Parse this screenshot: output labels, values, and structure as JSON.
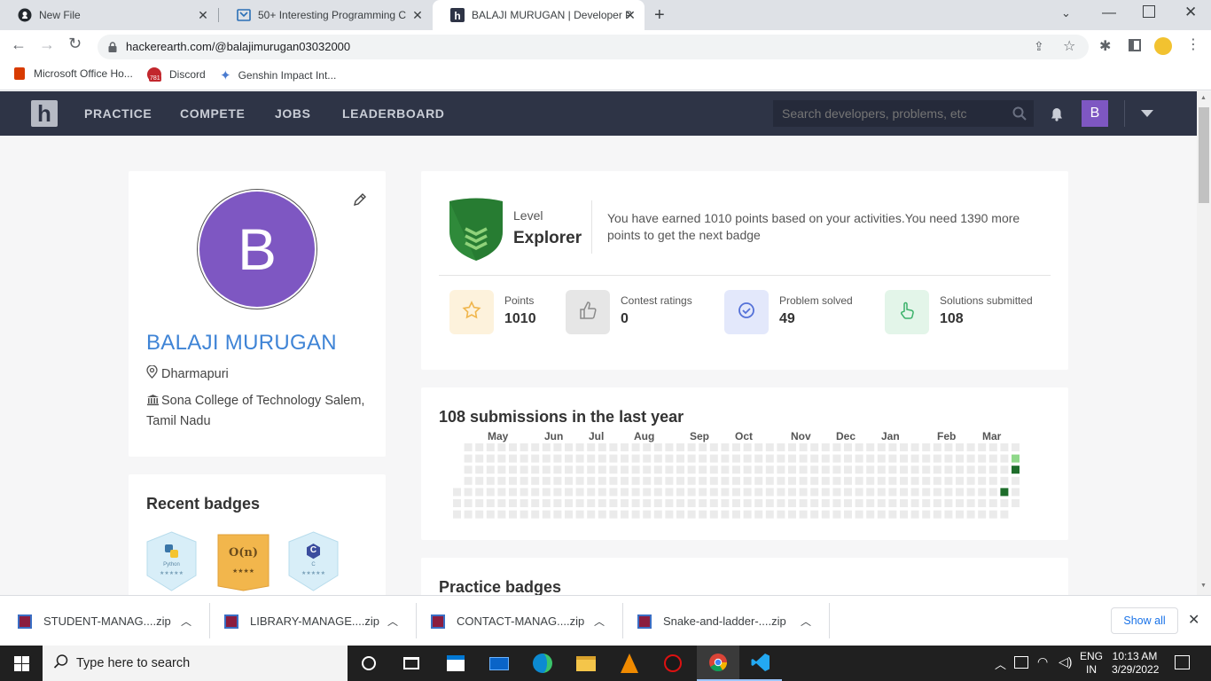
{
  "browser": {
    "tabs": [
      {
        "title": "New File",
        "favicon": "github-icon"
      },
      {
        "title": "50+ Interesting Programming C",
        "favicon": "article-icon"
      },
      {
        "title": "BALAJI MURUGAN | Developer P",
        "favicon": "hackerearth-icon"
      }
    ],
    "url": "hackerearth.com/@balajimurugan03032000",
    "bookmarks": [
      {
        "label": "Microsoft Office Ho...",
        "icon": "office-icon"
      },
      {
        "label": "Discord",
        "icon": "discord-icon",
        "badge": "781"
      },
      {
        "label": "Genshin Impact Int...",
        "icon": "star-icon"
      }
    ]
  },
  "site": {
    "logo": "h",
    "nav": [
      "PRACTICE",
      "COMPETE",
      "JOBS",
      "LEADERBOARD"
    ],
    "search_placeholder": "Search developers, problems, etc",
    "avatar_letter": "B",
    "accent": "#7e57c2",
    "nav_bg": "#2e3446"
  },
  "profile": {
    "avatar_letter": "B",
    "name": "BALAJI MURUGAN",
    "location": "Dharmapuri",
    "college": "Sona College of Technology Salem, Tamil Nadu",
    "name_color": "#3f84d6"
  },
  "badges_card": {
    "title": "Recent badges",
    "badges": [
      {
        "label": "Python",
        "stars": "★★★★★"
      },
      {
        "label": "O(n)",
        "stars": "★★★★"
      },
      {
        "label": "C",
        "stars": "★★★★★"
      }
    ]
  },
  "level": {
    "label": "Level",
    "value": "Explorer",
    "message": "You have earned 1010 points based on your activities.You need 1390 more points to get the next badge"
  },
  "stats": [
    {
      "label": "Points",
      "value": "1010",
      "icon": "star-outline-icon",
      "bg": "#fdf2dc",
      "color": "#f0b64d"
    },
    {
      "label": "Contest ratings",
      "value": "0",
      "icon": "thumbs-up-icon",
      "bg": "#e6e6e6",
      "color": "#8a8a8a"
    },
    {
      "label": "Problem solved",
      "value": "49",
      "icon": "check-circle-icon",
      "bg": "#e3e8fb",
      "color": "#5471d8"
    },
    {
      "label": "Solutions submitted",
      "value": "108",
      "icon": "pointer-hand-icon",
      "bg": "#e3f5e9",
      "color": "#3bb26a"
    }
  ],
  "heatmap": {
    "title": "108 submissions in the last year",
    "months": [
      "May",
      "Jun",
      "Jul",
      "Aug",
      "Sep",
      "Oct",
      "Nov",
      "Dec",
      "Jan",
      "Feb",
      "Mar"
    ],
    "active_cells": [
      {
        "week": 50,
        "day": 1,
        "level": 1
      },
      {
        "week": 50,
        "day": 2,
        "level": 3
      },
      {
        "week": 49,
        "day": 4,
        "level": 3
      }
    ]
  },
  "practice_badges": {
    "title": "Practice badges"
  },
  "downloads": {
    "items": [
      "STUDENT-MANAG....zip",
      "LIBRARY-MANAGE....zip",
      "CONTACT-MANAG....zip",
      "Snake-and-ladder-....zip"
    ],
    "show_all": "Show all"
  },
  "taskbar": {
    "search_placeholder": "Type here to search",
    "lang_top": "ENG",
    "lang_bottom": "IN",
    "time": "10:13 AM",
    "date": "3/29/2022"
  }
}
